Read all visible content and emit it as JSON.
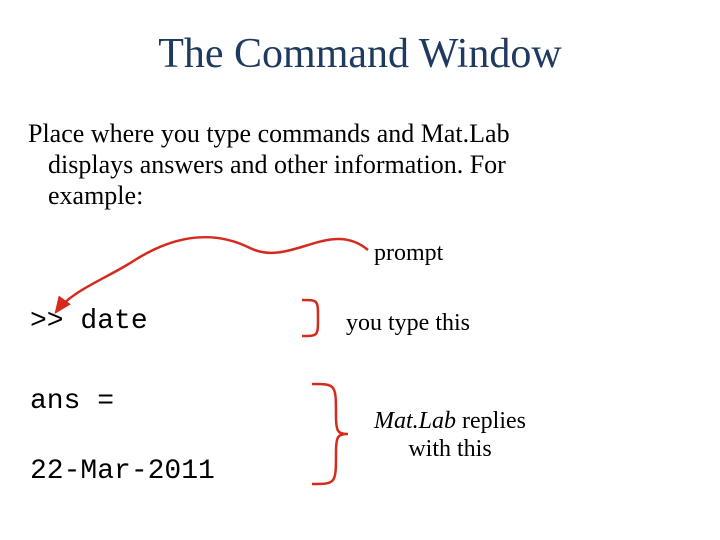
{
  "title": "The Command Window",
  "body": {
    "line1": "Place where you type commands and Mat.Lab",
    "line2": "displays answers and other information.  For",
    "line3": "example:"
  },
  "labels": {
    "prompt": "prompt",
    "you_type": "you type this",
    "matlab_name": "Mat.Lab",
    "replies_rest": " replies",
    "replies_line2": "with this"
  },
  "console": {
    "command": ">> date",
    "ans": "ans =",
    "output": "22-Mar-2011"
  },
  "colors": {
    "title": "#1f3a5f",
    "annotation": "#d52b1e"
  }
}
